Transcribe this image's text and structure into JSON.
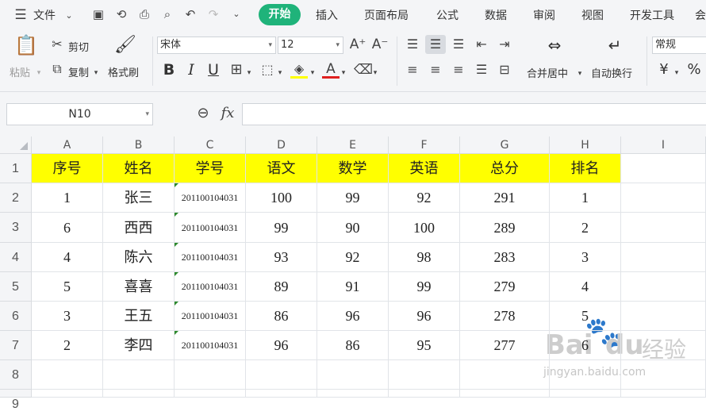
{
  "menubar": {
    "file_label": "文件",
    "tabs": [
      "开始",
      "插入",
      "页面布局",
      "公式",
      "数据",
      "审阅",
      "视图",
      "开发工具",
      "会"
    ]
  },
  "toolbar": {
    "paste": "粘贴",
    "cut": "剪切",
    "copy": "复制",
    "format_painter": "格式刷",
    "font_name": "宋体",
    "font_size": "12",
    "merge_center": "合并居中",
    "wrap_text": "自动换行",
    "number_format": "常规",
    "currency_symbol": "¥",
    "percent_symbol": "%",
    "bold": "B",
    "italic": "I",
    "underline": "U"
  },
  "formula_bar": {
    "name_box": "N10",
    "fx": "fx",
    "value": ""
  },
  "sheet": {
    "columns": [
      "A",
      "B",
      "C",
      "D",
      "E",
      "F",
      "G",
      "H",
      "I"
    ],
    "rows": [
      "1",
      "2",
      "3",
      "4",
      "5",
      "6",
      "7",
      "8",
      "9"
    ],
    "cells": [
      [
        "序号",
        "姓名",
        "学号",
        "语文",
        "数学",
        "英语",
        "总分",
        "排名",
        ""
      ],
      [
        "1",
        "张三",
        "201100104031",
        "100",
        "99",
        "92",
        "291",
        "1",
        ""
      ],
      [
        "6",
        "西西",
        "201100104031",
        "99",
        "90",
        "100",
        "289",
        "2",
        ""
      ],
      [
        "4",
        "陈六",
        "201100104031",
        "93",
        "92",
        "98",
        "283",
        "3",
        ""
      ],
      [
        "5",
        "喜喜",
        "201100104031",
        "89",
        "91",
        "99",
        "279",
        "4",
        ""
      ],
      [
        "3",
        "王五",
        "201100104031",
        "86",
        "96",
        "96",
        "278",
        "5",
        ""
      ],
      [
        "2",
        "李四",
        "201100104031",
        "96",
        "86",
        "95",
        "277",
        "6",
        ""
      ],
      [
        "",
        "",
        "",
        "",
        "",
        "",
        "",
        "",
        ""
      ],
      [
        "",
        "",
        "",
        "",
        "",
        "",
        "",
        "",
        ""
      ]
    ]
  },
  "watermark": {
    "brand": "Bai",
    "suffix": "du",
    "cn": "经验",
    "url": "jingyan.baidu.com"
  },
  "colors": {
    "accent": "#1fb37a",
    "header_fill": "#ffff00",
    "text_triangle": "#2d8a2d"
  }
}
